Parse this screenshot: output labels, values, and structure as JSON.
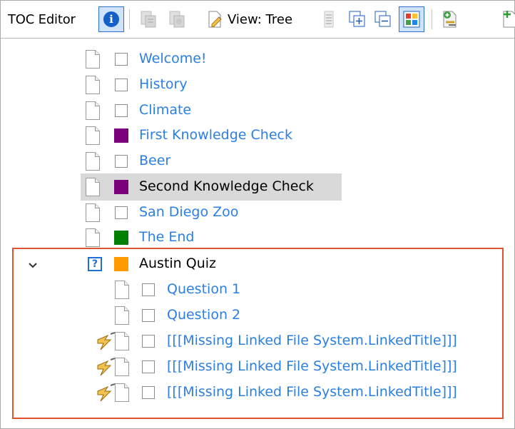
{
  "toolbar": {
    "title": "TOC Editor",
    "info_icon": "info-icon",
    "view_label": "View: Tree",
    "colors": {
      "accent": "#1560c8",
      "toggle_bg": "#cfe3fb"
    }
  },
  "tree": {
    "items": [
      {
        "label": "Welcome!",
        "swatch": "none",
        "linked": true
      },
      {
        "label": "History",
        "swatch": "none",
        "linked": true
      },
      {
        "label": "Climate",
        "swatch": "none",
        "linked": true
      },
      {
        "label": "First Knowledge Check",
        "swatch": "#7b007b",
        "linked": true
      },
      {
        "label": "Beer",
        "swatch": "none",
        "linked": true
      },
      {
        "label": "Second Knowledge Check",
        "swatch": "#7b007b",
        "linked": false,
        "selected": true
      },
      {
        "label": "San Diego Zoo",
        "swatch": "none",
        "linked": true
      },
      {
        "label": "The End",
        "swatch": "#008000",
        "linked": true
      }
    ],
    "quiz": {
      "label": "Austin Quiz",
      "icon": "question-icon",
      "swatch": "#ff9900",
      "expanded": true,
      "children": [
        {
          "label": "Question 1",
          "missing_link": false
        },
        {
          "label": "Question 2",
          "missing_link": false
        },
        {
          "label": "[[[Missing Linked File System.LinkedTitle]]]",
          "missing_link": true
        },
        {
          "label": "[[[Missing Linked File System.LinkedTitle]]]",
          "missing_link": true
        },
        {
          "label": "[[[Missing Linked File System.LinkedTitle]]]",
          "missing_link": true
        }
      ]
    }
  },
  "highlight_color": "#e0522e"
}
